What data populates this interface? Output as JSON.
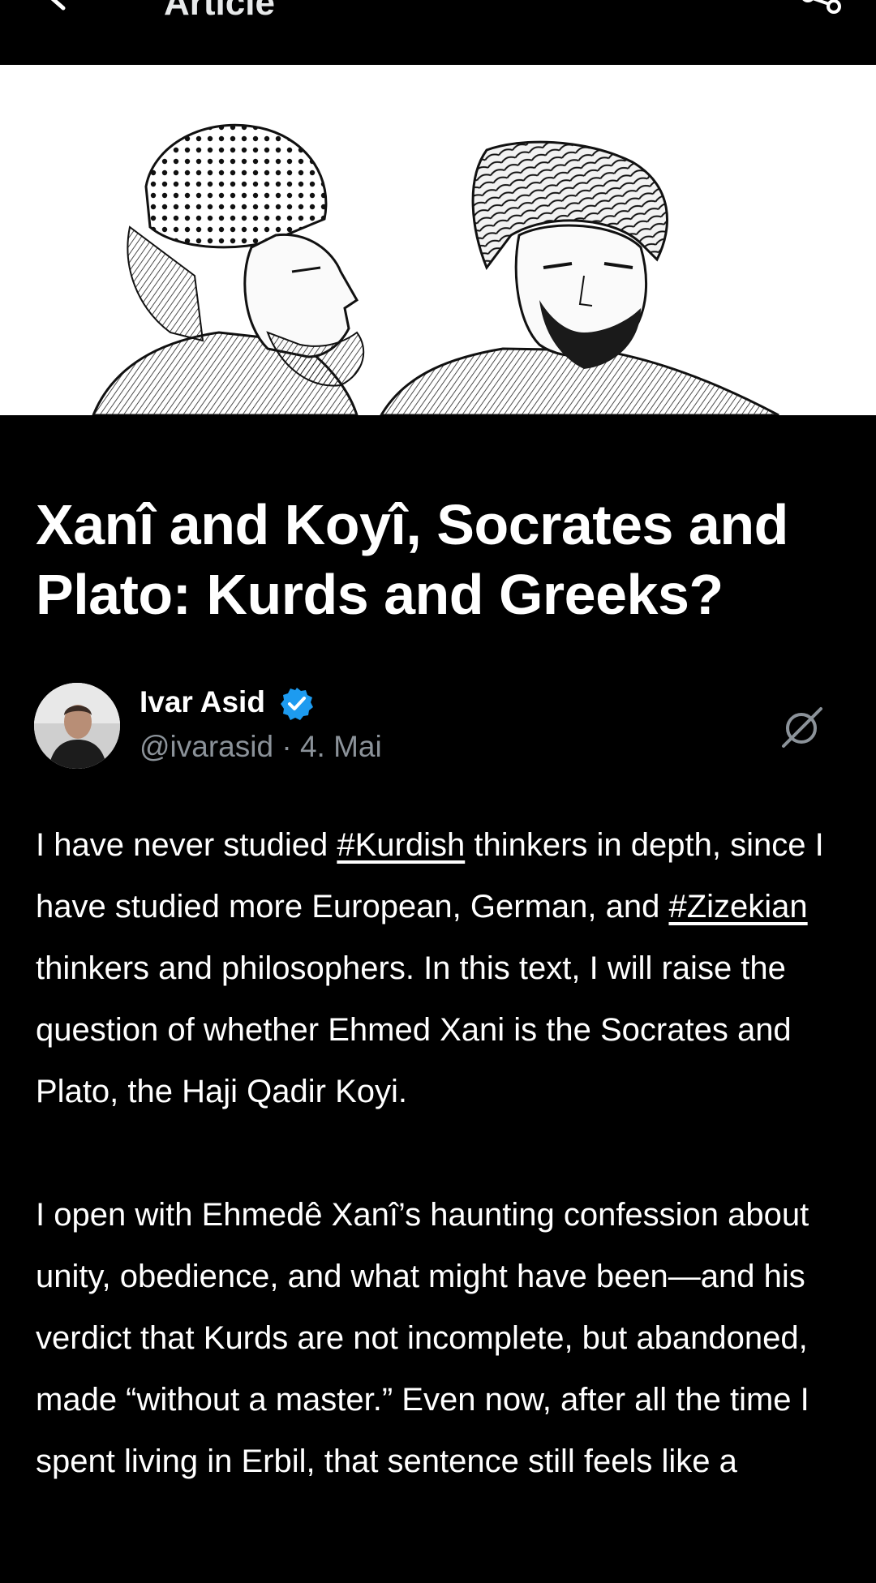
{
  "header": {
    "title": "Article",
    "back_icon": "arrow-left-icon",
    "share_icon": "share-icon"
  },
  "cover": {
    "alt_icon": "engraved-portraits"
  },
  "article": {
    "title": "Xanî and Koyî, Socrates and Plato: Kurds and Greeks?"
  },
  "author": {
    "name": "Ivar Asid",
    "handle": "@ivarasid",
    "separator": " · ",
    "date": "4. Mai",
    "verified_color": "#1d9bf0"
  },
  "body": {
    "p1_a": "I have never studied ",
    "p1_tag1": "#Kurdish",
    "p1_b": " thinkers in depth, since I have studied more European, German, and ",
    "p1_tag2": "#Zizekian",
    "p1_c": " thinkers and philosophers. In this text, I will raise the question of whether Ehmed Xani is the Socrates and Plato, the Haji Qadir Koyi.",
    "p2": "I open with Ehmedê Xanî’s haunting confession about unity, obedience, and what might have been—and his verdict that Kurds are not incomplete, but abandoned, made “without a master.” Even now, after all the time I spent living in Erbil, that sentence still feels like a"
  },
  "colors": {
    "background": "#000000",
    "text": "#ffffff",
    "muted": "#8b9299",
    "accent": "#1d9bf0"
  }
}
